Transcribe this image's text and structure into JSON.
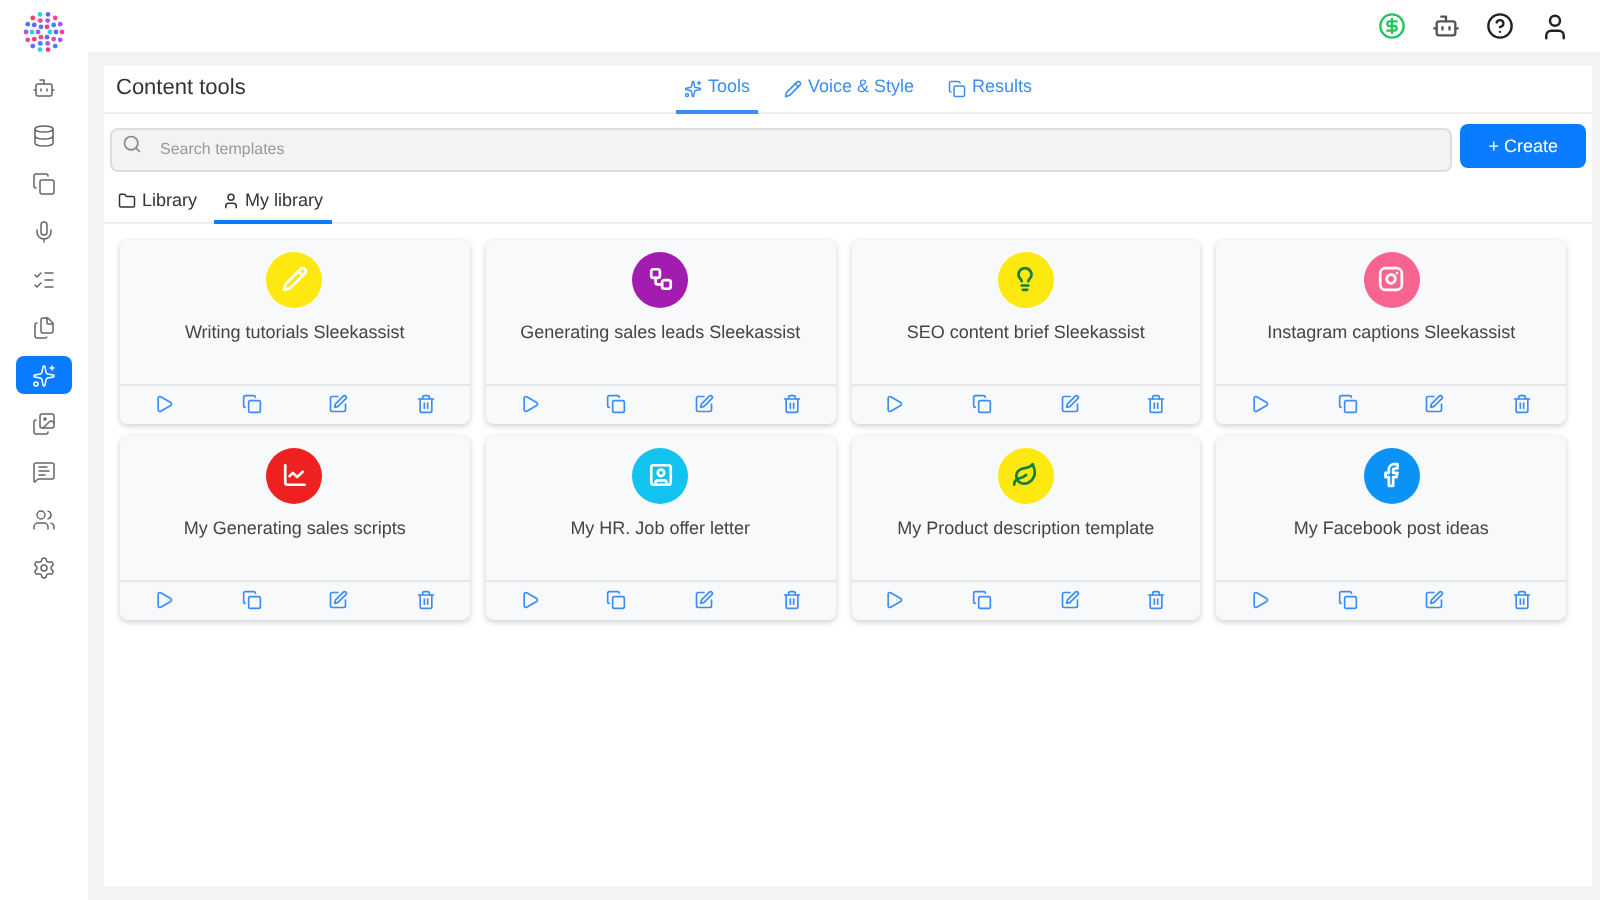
{
  "sidebar": {
    "items": [
      {
        "selected": false
      },
      {
        "selected": false
      },
      {
        "selected": false
      },
      {
        "selected": false
      },
      {
        "selected": false
      },
      {
        "selected": false
      },
      {
        "selected": true
      },
      {
        "selected": false
      },
      {
        "selected": false
      },
      {
        "selected": false
      },
      {
        "selected": false
      }
    ]
  },
  "header": {
    "title": "Content tools"
  },
  "tabs": [
    {
      "label": "Tools",
      "selected": true
    },
    {
      "label": "Voice & Style",
      "selected": false
    },
    {
      "label": "Results",
      "selected": false
    }
  ],
  "search": {
    "placeholder": "Search templates"
  },
  "create_button": {
    "label": "+ Create"
  },
  "library_tabs": [
    {
      "label": "Library",
      "selected": false
    },
    {
      "label": "My library",
      "selected": true
    }
  ],
  "cards": [
    {
      "title": "Writing tutorials Sleekassist",
      "color": "#fde910"
    },
    {
      "title": "Generating sales leads Sleekassist",
      "color": "#a21caf"
    },
    {
      "title": "SEO content brief Sleekassist",
      "color": "#fde910"
    },
    {
      "title": "Instagram captions Sleekassist",
      "color": "#f7648f"
    },
    {
      "title": "My Generating sales scripts",
      "color": "#ef2020"
    },
    {
      "title": "My HR. Job offer letter",
      "color": "#12c2ef"
    },
    {
      "title": "My Product description template",
      "color": "#fde910"
    },
    {
      "title": "My Facebook post ideas",
      "color": "#0a93f5"
    }
  ]
}
